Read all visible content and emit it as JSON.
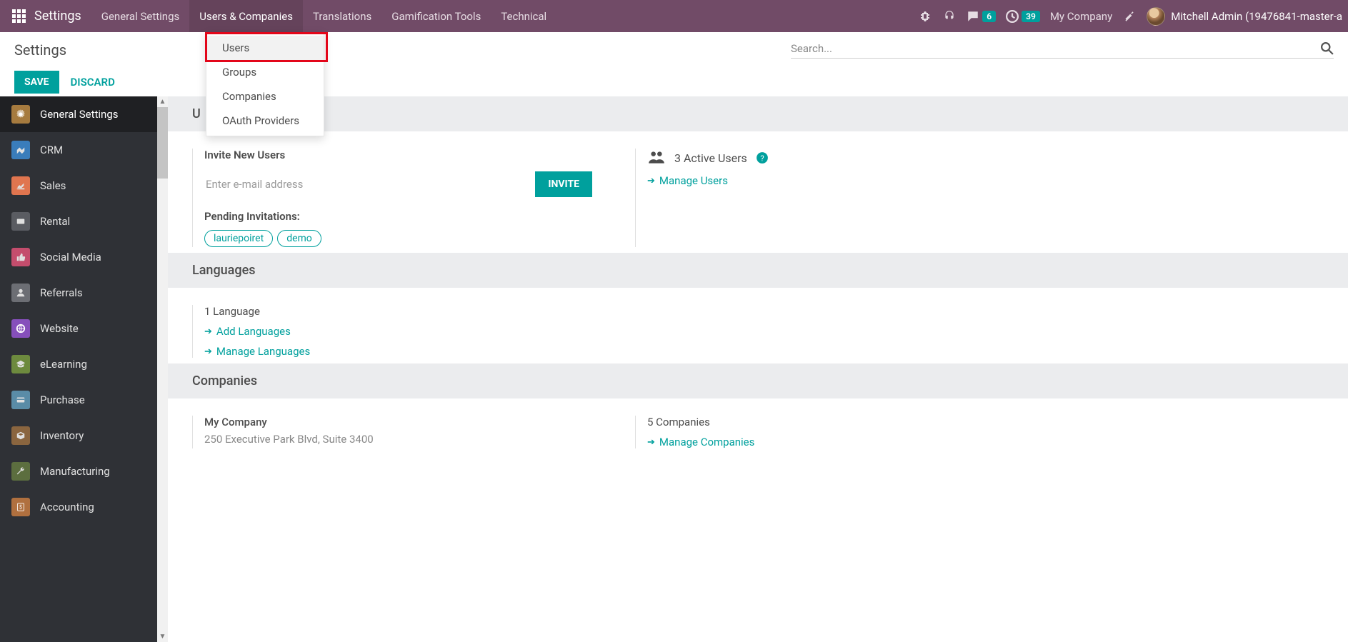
{
  "topbar": {
    "brand": "Settings",
    "menu": [
      {
        "label": "General Settings"
      },
      {
        "label": "Users & Companies"
      },
      {
        "label": "Translations"
      },
      {
        "label": "Gamification Tools"
      },
      {
        "label": "Technical"
      }
    ],
    "messaging_badge": "6",
    "activities_badge": "39",
    "company": "My Company",
    "user": "Mitchell Admin (19476841-master-a"
  },
  "dropdown": {
    "items": [
      {
        "label": "Users"
      },
      {
        "label": "Groups"
      },
      {
        "label": "Companies"
      },
      {
        "label": "OAuth Providers"
      }
    ]
  },
  "subheader": {
    "title": "Settings",
    "search_placeholder": "Search..."
  },
  "actions": {
    "save": "SAVE",
    "discard": "DISCARD"
  },
  "sidebar": {
    "items": [
      {
        "label": "General Settings"
      },
      {
        "label": "CRM"
      },
      {
        "label": "Sales"
      },
      {
        "label": "Rental"
      },
      {
        "label": "Social Media"
      },
      {
        "label": "Referrals"
      },
      {
        "label": "Website"
      },
      {
        "label": "eLearning"
      },
      {
        "label": "Purchase"
      },
      {
        "label": "Inventory"
      },
      {
        "label": "Manufacturing"
      },
      {
        "label": "Accounting"
      }
    ]
  },
  "users_section": {
    "header": "U",
    "invite_label": "Invite New Users",
    "email_placeholder": "Enter e-mail address",
    "invite_button": "INVITE",
    "pending_label": "Pending Invitations:",
    "pending": [
      "lauriepoiret",
      "demo"
    ],
    "active_text": "3 Active Users",
    "manage_link": "Manage Users"
  },
  "languages_section": {
    "header": "Languages",
    "count_text": "1 Language",
    "add_link": "Add Languages",
    "manage_link": "Manage Languages"
  },
  "companies_section": {
    "header": "Companies",
    "company_name": "My Company",
    "address": "250 Executive Park Blvd, Suite 3400",
    "count_text": "5 Companies",
    "manage_link": "Manage Companies"
  }
}
